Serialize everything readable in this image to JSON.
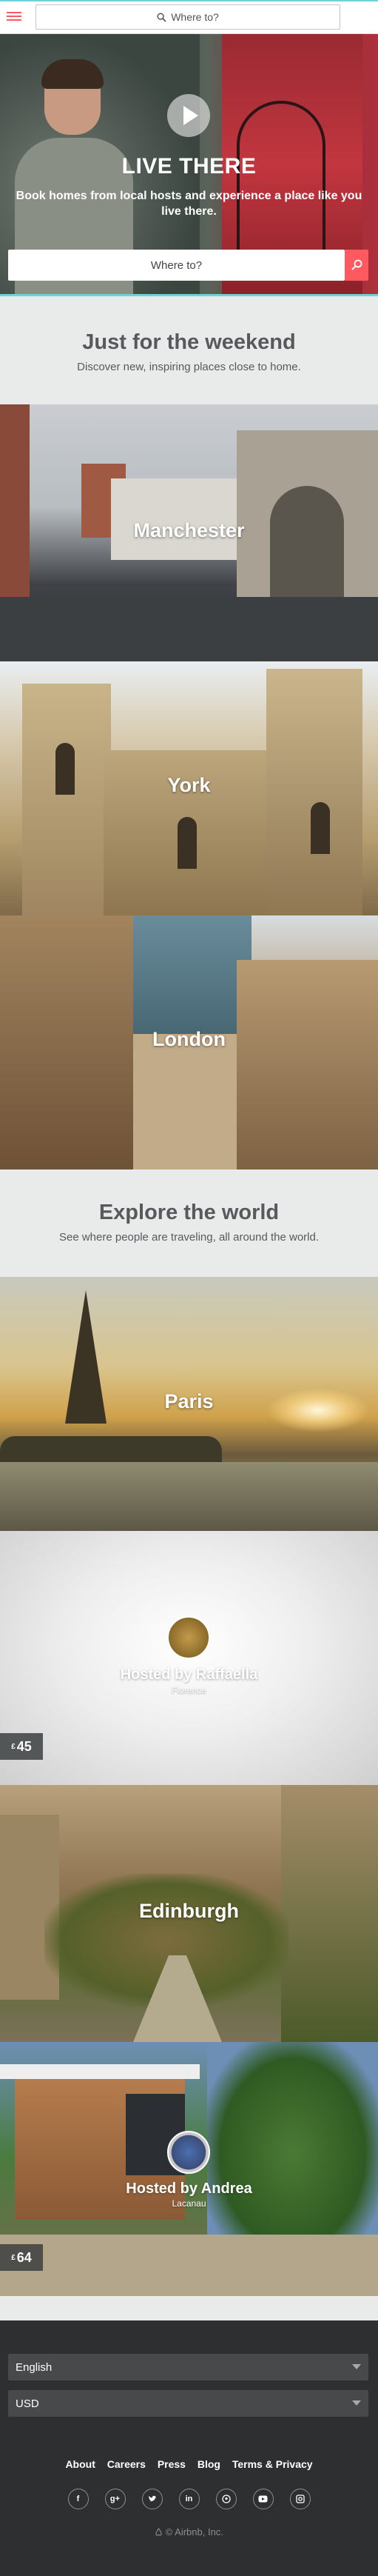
{
  "header": {
    "search_placeholder": "Where to?"
  },
  "hero": {
    "title": "LIVE THERE",
    "subtitle": "Book homes from local hosts and experience a place like you live there.",
    "search_placeholder": "Where to?"
  },
  "weekend": {
    "title": "Just for the weekend",
    "subtitle": "Discover new, inspiring places close to home.",
    "cities": [
      "Manchester",
      "York",
      "London"
    ]
  },
  "explore": {
    "title": "Explore the world",
    "subtitle": "See where people are traveling, all around the world.",
    "items": [
      {
        "label": "Paris"
      },
      {
        "host": "Hosted by Raffaella",
        "city": "Florence",
        "price_currency": "£",
        "price": "45"
      },
      {
        "label": "Edinburgh"
      },
      {
        "host": "Hosted by Andrea",
        "city": "Lacanau",
        "price_currency": "£",
        "price": "64"
      }
    ]
  },
  "footer": {
    "language": "English",
    "currency": "USD",
    "links": [
      "About",
      "Careers",
      "Press",
      "Blog",
      "Terms & Privacy"
    ],
    "social_icons": [
      "facebook-icon",
      "google-plus-icon",
      "twitter-icon",
      "linkedin-icon",
      "pinterest-icon",
      "youtube-icon",
      "instagram-icon"
    ],
    "copyright": "© Airbnb, Inc."
  },
  "colors": {
    "brand": "#ff5a5f",
    "accent": "#6fd3d6",
    "footer_bg": "#2d2f31",
    "section_bg": "#e9ebea"
  }
}
